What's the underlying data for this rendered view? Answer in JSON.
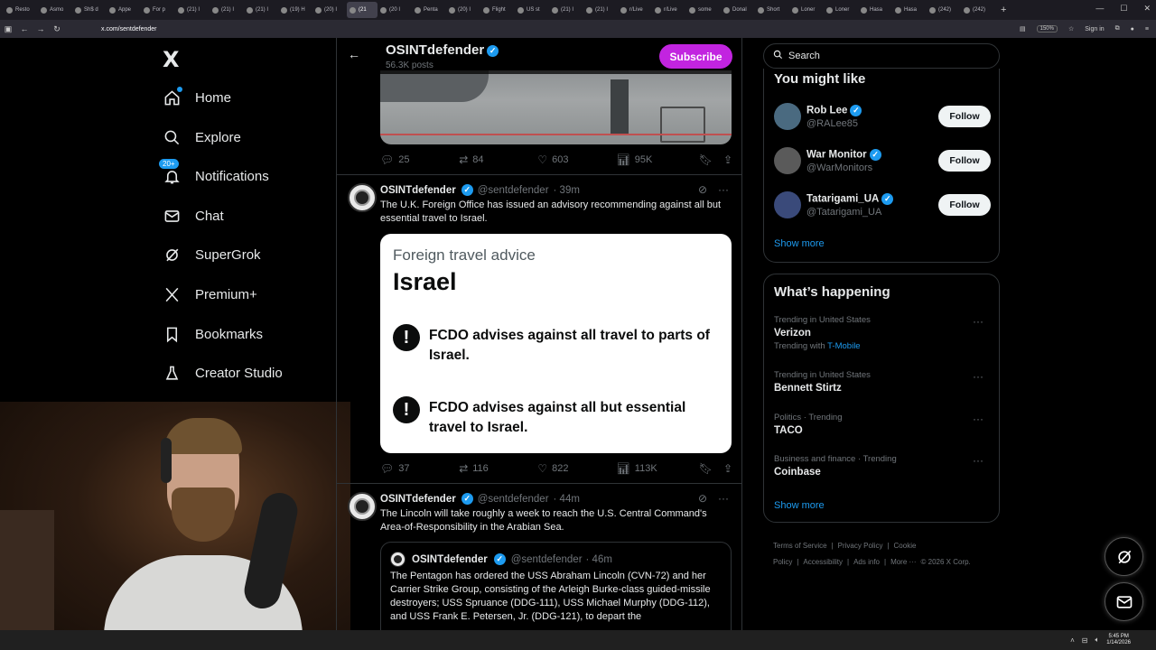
{
  "browser": {
    "tabs": [
      "Resto",
      "Asmo",
      "Sh$ d",
      "Appe",
      "For p",
      "(21) I",
      "(21) I",
      "(21) I",
      "(19) H",
      "(20) I",
      "(21",
      "(20 I",
      "Penta",
      "(20) I",
      "Flight",
      "US st",
      "(21) I",
      "(21) I",
      "r/Live",
      "r/Live",
      "some",
      "Donal",
      "Short",
      "Loner",
      "Loner",
      "Hasa",
      "Hasa",
      "(242)",
      "(242)"
    ],
    "active_tab_index": 10,
    "url": "x.com/sentdefender",
    "zoom": "150%",
    "sign_in": "Sign in"
  },
  "nav": {
    "logo": "X",
    "items": [
      {
        "label": "Home",
        "icon": "home-icon"
      },
      {
        "label": "Explore",
        "icon": "search-icon"
      },
      {
        "label": "Notifications",
        "icon": "bell-icon",
        "badge": "20+"
      },
      {
        "label": "Chat",
        "icon": "mail-icon"
      },
      {
        "label": "SuperGrok",
        "icon": "grok-icon"
      },
      {
        "label": "Premium+",
        "icon": "x-icon"
      },
      {
        "label": "Bookmarks",
        "icon": "bookmark-icon"
      },
      {
        "label": "Creator Studio",
        "icon": "flask-icon"
      }
    ]
  },
  "header": {
    "name": "OSINTdefender",
    "posts": "56.3K posts",
    "subscribe_label": "Subscribe"
  },
  "tweets": [
    {
      "reply": "25",
      "retweet": "84",
      "like": "603",
      "views": "95K"
    },
    {
      "name": "OSINTdefender",
      "handle": "@sentdefender",
      "time": "· 39m",
      "text": "The U.K. Foreign Office has issued an advisory recommending against all but essential travel to Israel.",
      "card": {
        "kicker": "Foreign travel advice",
        "country": "Israel",
        "warning_1": "FCDO advises against all travel to parts of Israel.",
        "warning_2": "FCDO advises against all but essential travel to Israel."
      },
      "reply": "37",
      "retweet": "116",
      "like": "822",
      "views": "113K"
    },
    {
      "name": "OSINTdefender",
      "handle": "@sentdefender",
      "time": "· 44m",
      "text": "The Lincoln will take roughly a week to reach the U.S. Central Command's Area-of-Responsibility in the Arabian Sea.",
      "quote": {
        "name": "OSINTdefender",
        "handle": "@sentdefender",
        "time": "· 46m",
        "text": "The Pentagon has ordered the USS Abraham Lincoln (CVN-72) and her Carrier Strike Group, consisting of the Arleigh Burke-class guided-missile destroyers; USS Spruance (DDG-111), USS Michael Murphy (DDG-112), and USS Frank E. Petersen, Jr. (DDG-121), to depart the"
      }
    }
  ],
  "search": {
    "placeholder": "Search"
  },
  "who_to_follow": {
    "title": "You might like",
    "users": [
      {
        "name": "Rob Lee",
        "handle": "@RALee85",
        "button": "Follow",
        "avatar_color": "#4a6a80"
      },
      {
        "name": "War Monitor",
        "handle": "@WarMonitors",
        "button": "Follow",
        "avatar_color": "#5a5a5a"
      },
      {
        "name": "Tatarigami_UA",
        "handle": "@Tatarigami_UA",
        "button": "Follow",
        "avatar_color": "#3a4a7a"
      }
    ],
    "show_more": "Show more"
  },
  "whats_happening": {
    "title": "What’s happening",
    "trends": [
      {
        "context": "Trending in United States",
        "topic": "Verizon",
        "with_prefix": "Trending with",
        "with_link": "T-Mobile"
      },
      {
        "context": "Trending in United States",
        "topic": "Bennett Stirtz"
      },
      {
        "context": "Politics · Trending",
        "topic": "TACO"
      },
      {
        "context": "Business and finance · Trending",
        "topic": "Coinbase"
      }
    ],
    "show_more": "Show more"
  },
  "footer": {
    "links": [
      "Terms of Service",
      "|",
      "Privacy Policy",
      "|",
      "Cookie Policy",
      "|",
      "Accessibility",
      "|",
      "Ads info",
      "|",
      "More ···",
      "© 2026 X Corp."
    ]
  },
  "taskbar": {
    "time": "5:45 PM",
    "date": "1/14/2026"
  }
}
